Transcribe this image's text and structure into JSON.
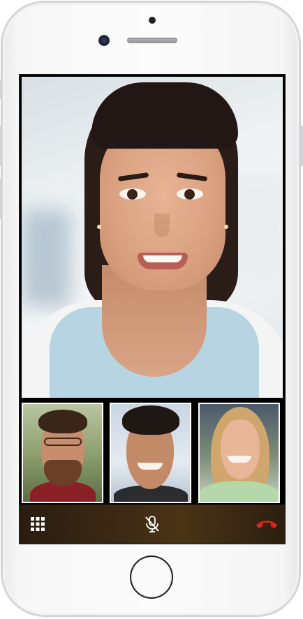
{
  "device": {
    "model": "smartphone",
    "frame_color": "#f7f7f8"
  },
  "call": {
    "main_participant": "woman-smiling",
    "participants": [
      {
        "id": "participant-1",
        "description": "man-with-glasses"
      },
      {
        "id": "participant-2",
        "description": "man-smiling"
      },
      {
        "id": "participant-3",
        "description": "woman-blonde"
      }
    ]
  },
  "controls": {
    "keypad_icon": "keypad-grid-icon",
    "mute_icon": "microphone-muted-icon",
    "hangup_icon": "phone-hangup-icon",
    "hangup_color": "#e0221b",
    "icon_color": "#ffffff"
  }
}
